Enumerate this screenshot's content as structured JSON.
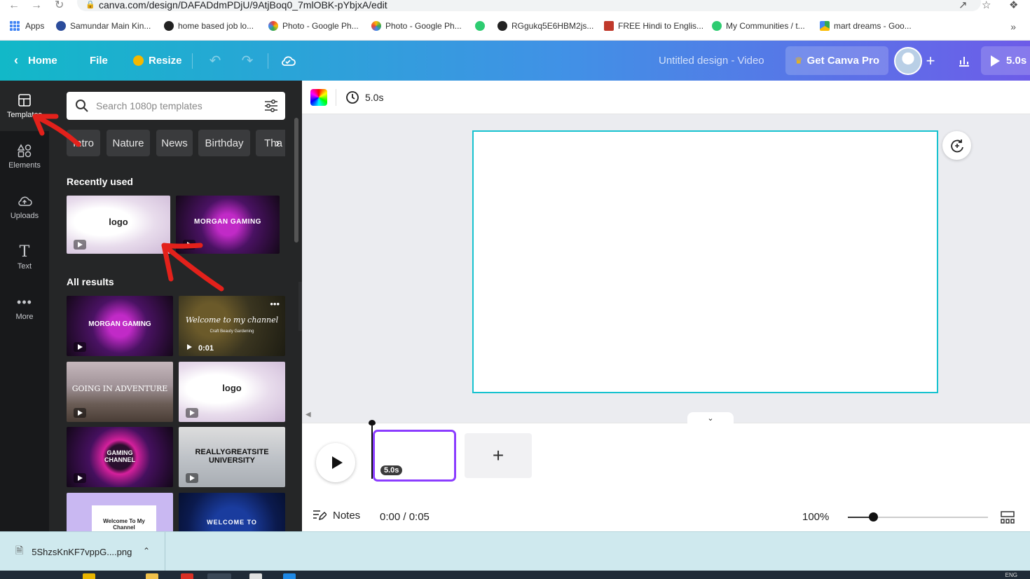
{
  "browser": {
    "url": "canva.com/design/DAFADdmPDjU/9AtjBoq0_7mlOBK-pYbjxA/edit",
    "bookmarks": [
      {
        "label": "Apps",
        "icon": "apps-grid-icon"
      },
      {
        "label": "Samundar Main Kin...",
        "icon": "hindi-h-icon",
        "color": "#2b4c9b"
      },
      {
        "label": "home based job lo...",
        "icon": "globe-icon",
        "color": "#222222"
      },
      {
        "label": "Photo - Google Ph...",
        "icon": "google-photos-icon",
        "color": "#ea4335"
      },
      {
        "label": "Photo - Google Ph...",
        "icon": "google-photos-icon",
        "color": "#fbbc05"
      },
      {
        "label": "",
        "icon": "green-circle-icon",
        "color": "#2ecc71"
      },
      {
        "label": "RGgukq5E6HBM2js...",
        "icon": "globe-icon",
        "color": "#222222"
      },
      {
        "label": "FREE Hindi to Englis...",
        "icon": "hindi-a-icon",
        "color": "#c0392b"
      },
      {
        "label": "My Communities / t...",
        "icon": "green-circle-icon",
        "color": "#2ecc71"
      },
      {
        "label": "mart dreams - Goo...",
        "icon": "google-drive-icon",
        "color": "#34a853"
      }
    ]
  },
  "header": {
    "home": "Home",
    "file": "File",
    "resize": "Resize",
    "title": "Untitled design - Video",
    "get_pro": "Get Canva Pro",
    "present_duration": "5.0s"
  },
  "rail": [
    {
      "label": "Templates",
      "icon": "templates-icon",
      "active": true
    },
    {
      "label": "Elements",
      "icon": "elements-icon"
    },
    {
      "label": "Uploads",
      "icon": "uploads-icon"
    },
    {
      "label": "Text",
      "icon": "text-icon"
    },
    {
      "label": "More",
      "icon": "more-icon"
    }
  ],
  "panel": {
    "search_placeholder": "Search 1080p templates",
    "chips": [
      "Intro",
      "Nature",
      "News",
      "Birthday",
      "Tha"
    ],
    "recently_used_title": "Recently used",
    "all_results_title": "All results",
    "recently_used": [
      {
        "text": "logo",
        "theme": "light"
      },
      {
        "text": "MORGAN GAMING",
        "theme": "purple"
      }
    ],
    "all_results": [
      {
        "text": "MORGAN GAMING",
        "theme": "purple"
      },
      {
        "text": "Welcome to my channel",
        "sub": "Craft Beauty Gardening",
        "theme": "floral",
        "duration": "0:01"
      },
      {
        "text": "GOING IN ADVENTURE",
        "theme": "mountain"
      },
      {
        "text": "logo",
        "theme": "light"
      },
      {
        "text": "GAMING CHANNEL",
        "theme": "neon"
      },
      {
        "text": "REALLYGREATSITE UNIVERSITY",
        "theme": "city"
      },
      {
        "text": "Welcome To My Channel",
        "theme": "lavender"
      },
      {
        "text": "WELCOME TO",
        "theme": "navy"
      }
    ]
  },
  "editor": {
    "duration": "5.0s",
    "clip_duration": "5.0s",
    "notes": "Notes",
    "time": "0:00 / 0:05",
    "zoom": "100%",
    "zoom_level": 0.18
  },
  "downloads": {
    "file": "5ShzsKnKF7vppG....png"
  },
  "taskbar": {
    "lang": "ENG"
  }
}
